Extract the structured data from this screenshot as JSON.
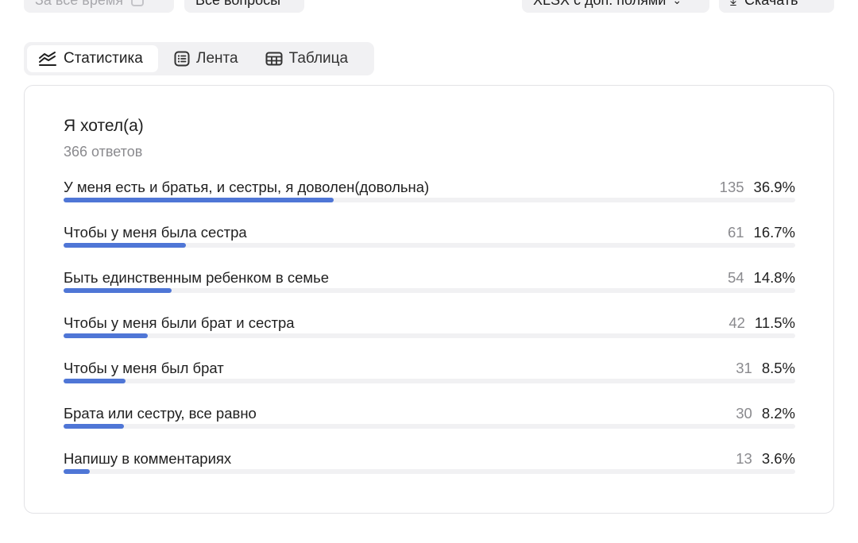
{
  "toolbar": {
    "period_label": "За все время",
    "questions_label": "Все вопросы",
    "export_label": "XLSX с доп. полями",
    "download_label": "Скачать"
  },
  "tabs": [
    {
      "label": "Статистика",
      "icon": "chart-icon",
      "active": true
    },
    {
      "label": "Лента",
      "icon": "list-icon",
      "active": false
    },
    {
      "label": "Таблица",
      "icon": "table-icon",
      "active": false
    }
  ],
  "question": {
    "title": "Я хотел(а)",
    "responses": "366 ответов"
  },
  "colors": {
    "bar": "#4f76d6",
    "track": "#f1f1f3"
  },
  "chart_data": {
    "type": "bar",
    "categories": [
      "У меня есть и братья, и сестры, я доволен(довольна)",
      "Чтобы у меня была сестра",
      "Быть единственным ребенком в семье",
      "Чтобы у меня были брат и сестра",
      "Чтобы у меня был брат",
      "Брата или сестру, все равно",
      "Напишу в комментариях"
    ],
    "counts": [
      135,
      61,
      54,
      42,
      31,
      30,
      13
    ],
    "percents": [
      "36.9%",
      "16.7%",
      "14.8%",
      "11.5%",
      "8.5%",
      "8.2%",
      "3.6%"
    ],
    "values": [
      36.9,
      16.7,
      14.8,
      11.5,
      8.5,
      8.2,
      3.6
    ]
  }
}
